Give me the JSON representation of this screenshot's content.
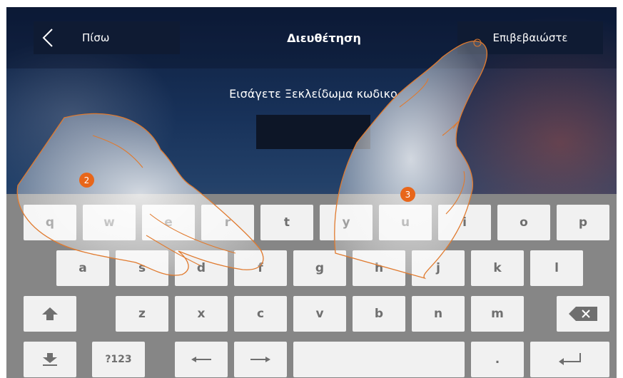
{
  "header": {
    "back_label": "Πίσω",
    "title": "Διευθέτηση",
    "confirm_label": "Επιβεβαιώστε"
  },
  "main": {
    "prompt": "Εισάγετε Ξεκλείδωμα κωδικο",
    "code_value": ""
  },
  "keyboard": {
    "row1": [
      "q",
      "w",
      "e",
      "r",
      "t",
      "y",
      "u",
      "i",
      "o",
      "p"
    ],
    "row2": [
      "a",
      "s",
      "d",
      "f",
      "g",
      "h",
      "j",
      "k",
      "l"
    ],
    "row3": [
      "z",
      "x",
      "c",
      "v",
      "b",
      "n",
      "m"
    ],
    "symbols_label": "?123",
    "dot_label": ".",
    "icons": [
      "shift-up-icon",
      "backspace-icon",
      "hide-keyboard-icon",
      "arrow-left-icon",
      "arrow-right-icon",
      "enter-icon"
    ]
  },
  "annotations": {
    "step_2": "2",
    "step_3": "3"
  },
  "colors": {
    "badge": "#e8661a",
    "hand_outline": "#e07a2e",
    "keyboard_bg": "#868686",
    "key_bg": "#f1f1f1",
    "header_button_bg": "#0f1b33"
  }
}
